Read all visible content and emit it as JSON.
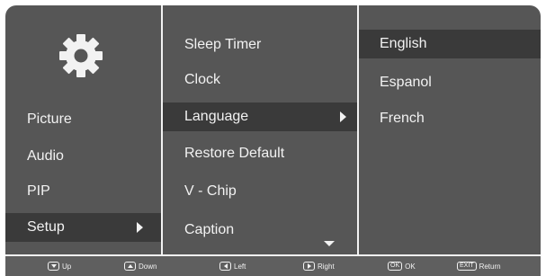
{
  "main_menu": {
    "icon": "gear-icon",
    "items": [
      {
        "label": "Picture"
      },
      {
        "label": "Audio"
      },
      {
        "label": "PIP"
      },
      {
        "label": "Setup",
        "selected": true
      }
    ]
  },
  "setup_menu": {
    "items": [
      {
        "label": "Sleep Timer"
      },
      {
        "label": "Clock"
      },
      {
        "label": "Language",
        "selected": true
      },
      {
        "label": "Restore Default"
      },
      {
        "label": "V - Chip"
      },
      {
        "label": "Caption"
      }
    ],
    "scroll_icon": "scroll-down-icon"
  },
  "language_menu": {
    "items": [
      {
        "label": "English",
        "selected": true
      },
      {
        "label": "Espanol"
      },
      {
        "label": "French"
      }
    ]
  },
  "hints": [
    {
      "key_icon": "down-arrow-key-icon",
      "label": "Up"
    },
    {
      "key_icon": "up-arrow-key-icon",
      "label": "Down"
    },
    {
      "key_icon": "left-arrow-key-icon",
      "label": "Left"
    },
    {
      "key_icon": "right-arrow-key-icon",
      "label": "Right"
    },
    {
      "key_text": "OK",
      "label": "OK"
    },
    {
      "key_text": "EXIT",
      "label": "Return"
    }
  ],
  "colors": {
    "panel": "#565656",
    "selected": "#3a3a3a",
    "text": "#f2f2f2",
    "hint_bar": "#5f5f5f"
  }
}
